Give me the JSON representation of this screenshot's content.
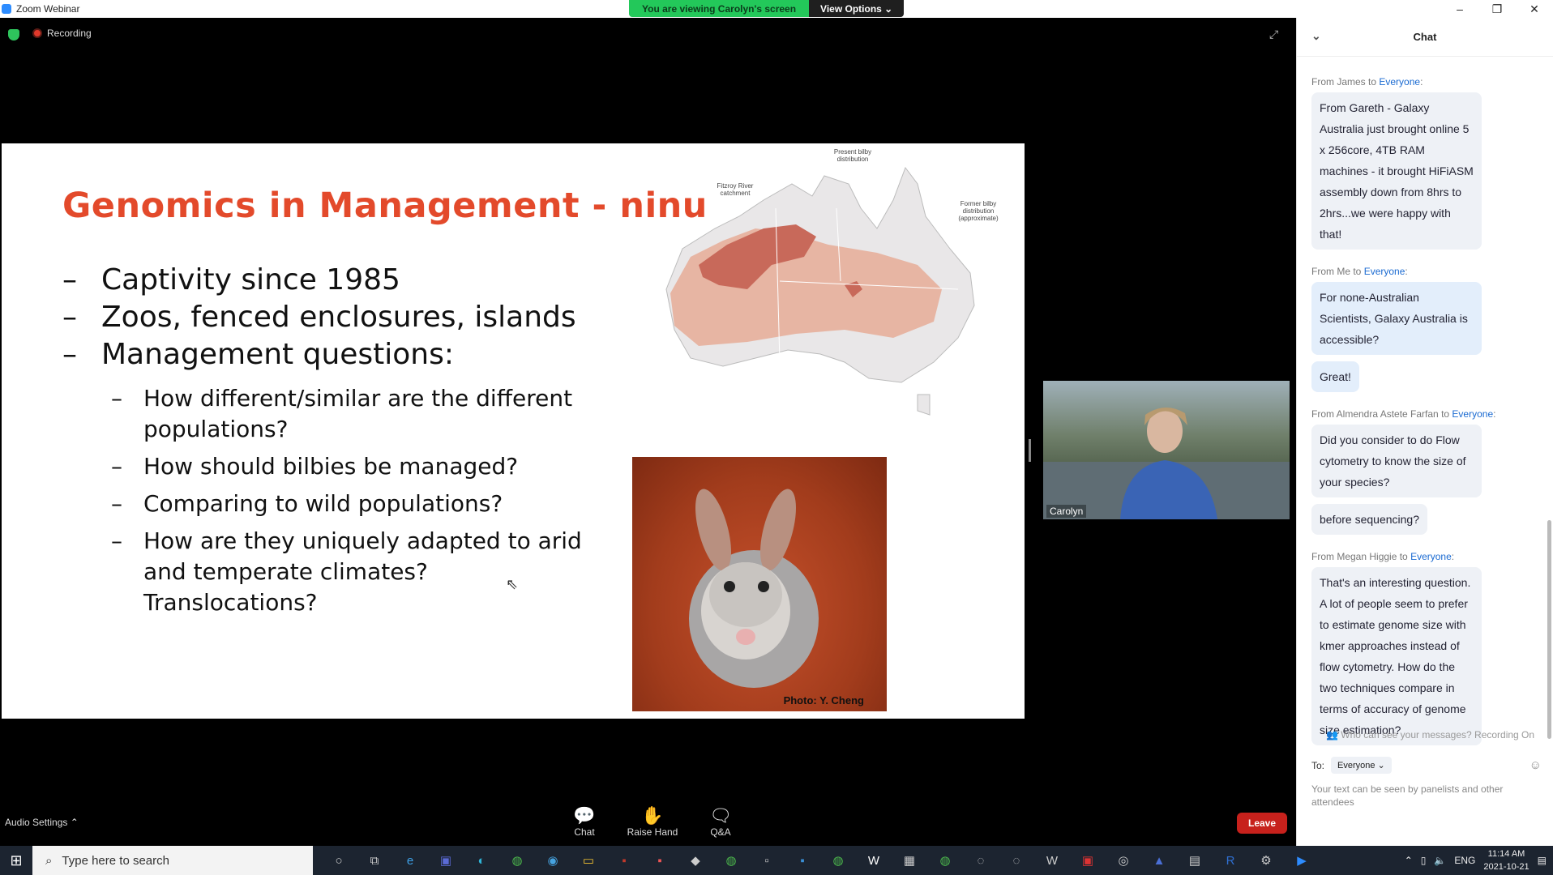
{
  "window": {
    "title": "Zoom Webinar",
    "minimize": "–",
    "restore": "❐",
    "close": "✕"
  },
  "banner": {
    "viewing_text": "You are viewing Carolyn's screen",
    "view_options_label": "View Options ⌄"
  },
  "meeting": {
    "recording_label": "Recording",
    "expand_glyph": "⤢"
  },
  "slide": {
    "title": "Genomics in Management -  ninu",
    "bullets": [
      "Captivity since 1985",
      "Zoos, fenced enclosures, islands",
      "Management questions:"
    ],
    "sub_bullets": [
      "How different/similar are the different populations?",
      "How should bilbies be managed?",
      "Comparing to wild populations?",
      "How are they uniquely adapted to arid and temperate climates? Translocations?"
    ],
    "dash": "–",
    "map_labels": {
      "present": "Present bilby distribution",
      "fitzroy": "Fitzroy River catchment",
      "former": "Former bilby distribution (approximate)"
    },
    "photo_credit": "Photo: Y. Cheng"
  },
  "video": {
    "participant_name": "Carolyn"
  },
  "toolbar": {
    "audio_settings": "Audio Settings ⌃",
    "chat_label": "Chat",
    "raise_hand_label": "Raise Hand",
    "qa_label": "Q&A",
    "leave_label": "Leave"
  },
  "chat": {
    "title": "Chat",
    "messages": [
      {
        "from": "From James to ",
        "to": "Everyone",
        "suffix": ":",
        "bubbles": [
          "From Gareth - Galaxy Australia just brought online 5 x 256core, 4TB RAM machines - it brought HiFiASM assembly down from 8hrs to 2hrs...we were happy with that!"
        ]
      },
      {
        "from": "From Me to ",
        "to": "Everyone",
        "suffix": ":",
        "bubbles": [
          "For none-Australian Scientists, Galaxy Australia is accessible?",
          "Great!"
        ]
      },
      {
        "from": "From Almendra Astete Farfan to ",
        "to": "Everyone",
        "suffix": ":",
        "bubbles": [
          "Did you consider to do Flow cytometry to know the size of your species?",
          "before sequencing?"
        ]
      },
      {
        "from": "From Megan Higgie to ",
        "to": "Everyone",
        "suffix": ":",
        "bubbles": [
          "That's an interesting question. A lot of people seem to prefer to estimate genome size with kmer approaches instead of flow cytometry. How do the two techniques compare in terms of accuracy of genome size estimation?"
        ]
      }
    ],
    "visibility_note": "Who can see your messages? Recording On",
    "to_label": "To:",
    "to_value": "Everyone ⌄",
    "input_hint": "Your text can be seen by panelists and other attendees"
  },
  "taskbar": {
    "search_placeholder": "Type here to search",
    "language": "ENG",
    "time": "11:14 AM",
    "date": "2021-10-21"
  },
  "colors": {
    "slide_title": "#e34a2b",
    "banner_green": "#23c85a",
    "leave_red": "#c7211c",
    "chat_link": "#1a6ad1"
  }
}
